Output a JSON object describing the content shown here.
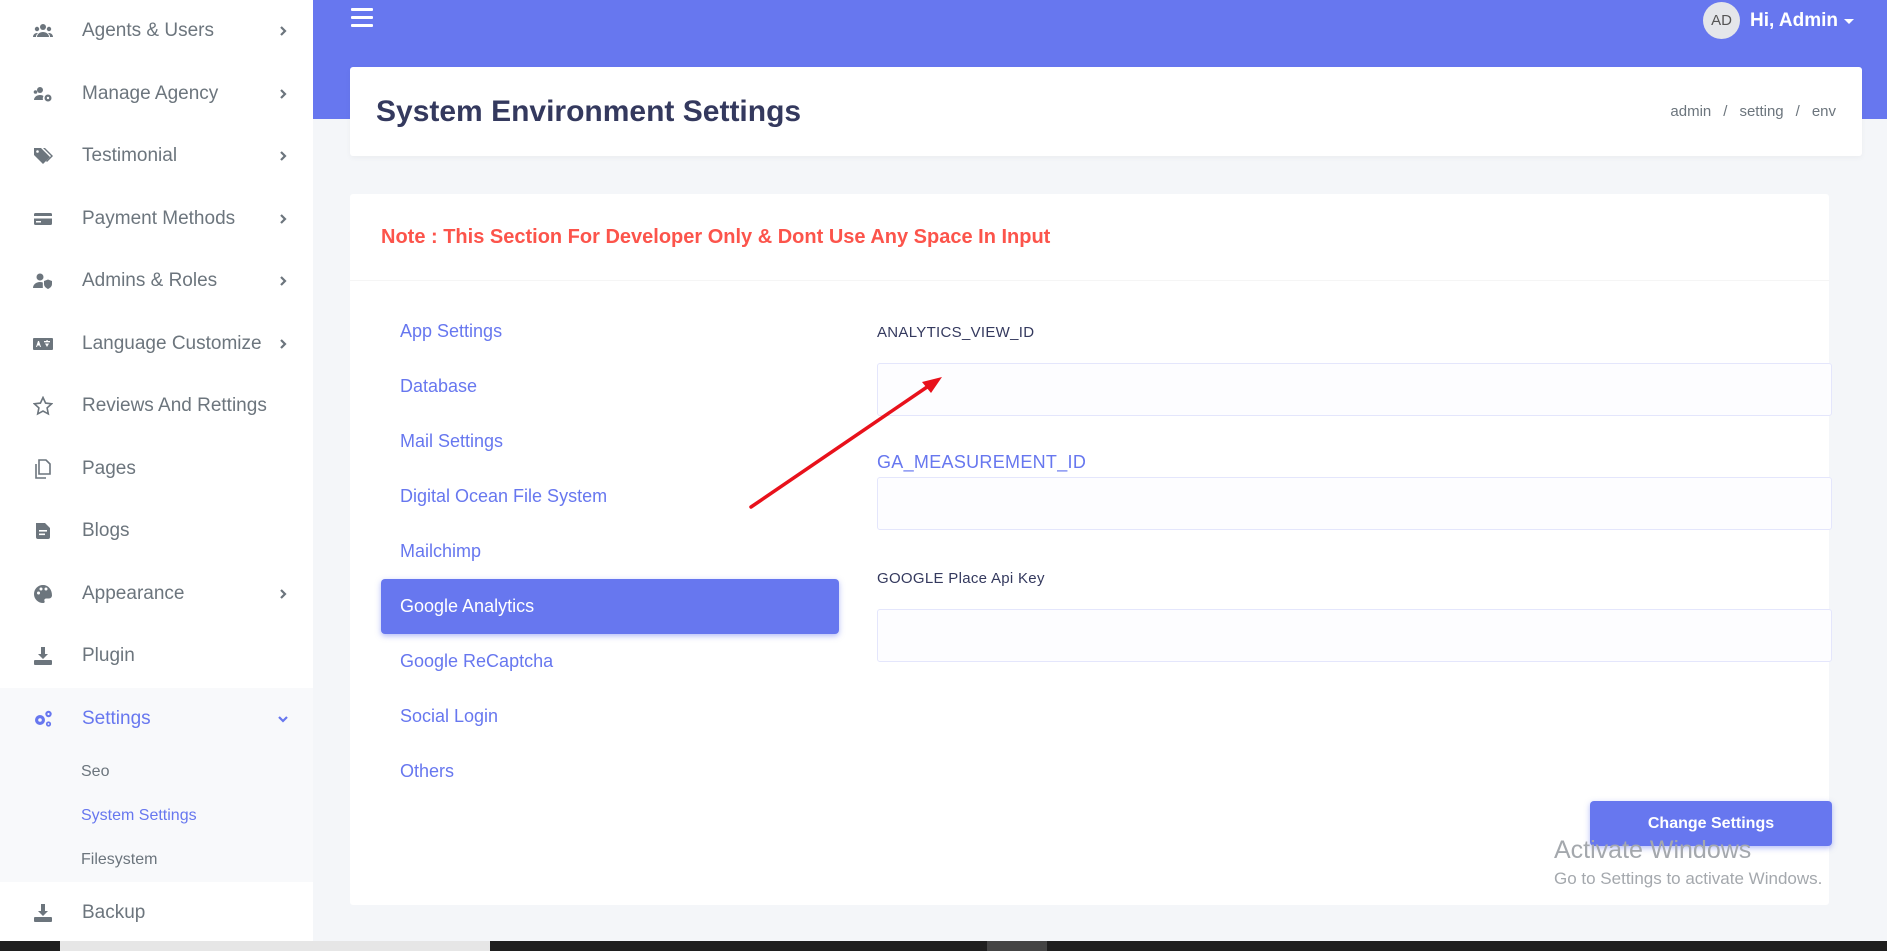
{
  "sidebar": {
    "items": [
      {
        "label": "Agents & Users",
        "icon": "users-icon"
      },
      {
        "label": "Manage Agency",
        "icon": "users-cog-icon"
      },
      {
        "label": "Testimonial",
        "icon": "tags-icon"
      },
      {
        "label": "Payment Methods",
        "icon": "credit-card-icon"
      },
      {
        "label": "Admins & Roles",
        "icon": "user-shield-icon"
      },
      {
        "label": "Language Customize",
        "icon": "language-icon"
      },
      {
        "label": "Reviews And Rettings",
        "icon": "star-icon"
      },
      {
        "label": "Pages",
        "icon": "copy-icon"
      },
      {
        "label": "Blogs",
        "icon": "blog-icon"
      },
      {
        "label": "Appearance",
        "icon": "palette-icon"
      },
      {
        "label": "Plugin",
        "icon": "download-icon"
      },
      {
        "label": "Settings",
        "icon": "cogs-icon"
      },
      {
        "label": "Backup",
        "icon": "download-icon"
      }
    ],
    "settings_sub": [
      {
        "label": "Seo"
      },
      {
        "label": "System Settings"
      },
      {
        "label": "Filesystem"
      }
    ]
  },
  "header": {
    "avatar_initials": "AD",
    "user_greeting": "Hi, Admin"
  },
  "page": {
    "title": "System Environment Settings",
    "breadcrumb": [
      "admin",
      "setting",
      "env"
    ],
    "breadcrumb_sep": "/"
  },
  "note": "Note : This Section For Developer Only & Dont Use Any Space In Input",
  "tabs": [
    {
      "label": "App Settings"
    },
    {
      "label": "Database"
    },
    {
      "label": "Mail Settings"
    },
    {
      "label": "Digital Ocean File System"
    },
    {
      "label": "Mailchimp"
    },
    {
      "label": "Google Analytics"
    },
    {
      "label": "Google ReCaptcha"
    },
    {
      "label": "Social Login"
    },
    {
      "label": "Others"
    }
  ],
  "form": {
    "fields": [
      {
        "label": "ANALYTICS_VIEW_ID",
        "value": ""
      },
      {
        "label": "GA_MEASUREMENT_ID",
        "value": ""
      },
      {
        "label": "GOOGLE Place Api Key",
        "value": ""
      }
    ],
    "submit_label": "Change Settings"
  },
  "watermark": {
    "title": "Activate Windows",
    "subtitle": "Go to Settings to activate Windows."
  },
  "colors": {
    "primary": "#6777ef",
    "danger": "#fc544b",
    "annotation_arrow": "#e8111b"
  }
}
